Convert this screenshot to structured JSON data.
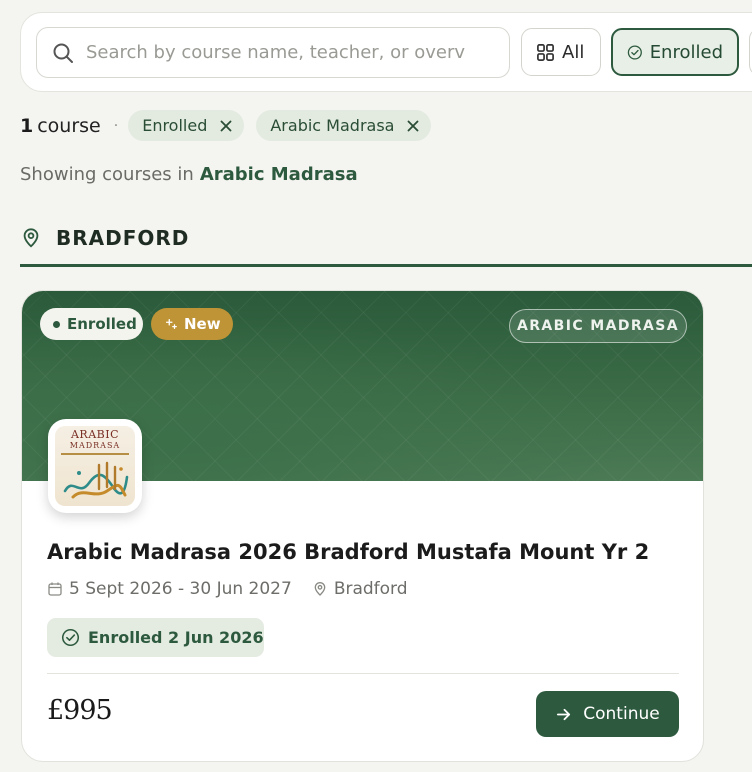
{
  "search": {
    "placeholder": "Search by course name, teacher, or overvie"
  },
  "filters": {
    "all_label": "All",
    "enrolled_label": "Enrolled"
  },
  "results": {
    "count": "1",
    "count_label": "course",
    "separator": "·",
    "active_tags": [
      {
        "label": "Enrolled"
      },
      {
        "label": "Arabic Madrasa"
      }
    ]
  },
  "showing": {
    "prefix": "Showing courses in",
    "category": "Arabic Madrasa"
  },
  "region": {
    "name": "BRADFORD"
  },
  "course": {
    "status_badge": "Enrolled",
    "new_badge": "New",
    "category_badge": "ARABIC MADRASA",
    "logo_text_line1": "ARABIC",
    "logo_text_line2": "MADRASA",
    "title": "Arabic Madrasa 2026 Bradford Mustafa Mount Yr 2",
    "dates": "5 Sept 2026 - 30 Jun 2027",
    "location": "Bradford",
    "enrolled_note": "Enrolled 2 Jun 2026",
    "price": "£995",
    "continue_label": "Continue"
  },
  "colors": {
    "primary_green": "#2d5a3e",
    "new_badge_gold": "#bf9436",
    "background": "#f4f4f1"
  }
}
